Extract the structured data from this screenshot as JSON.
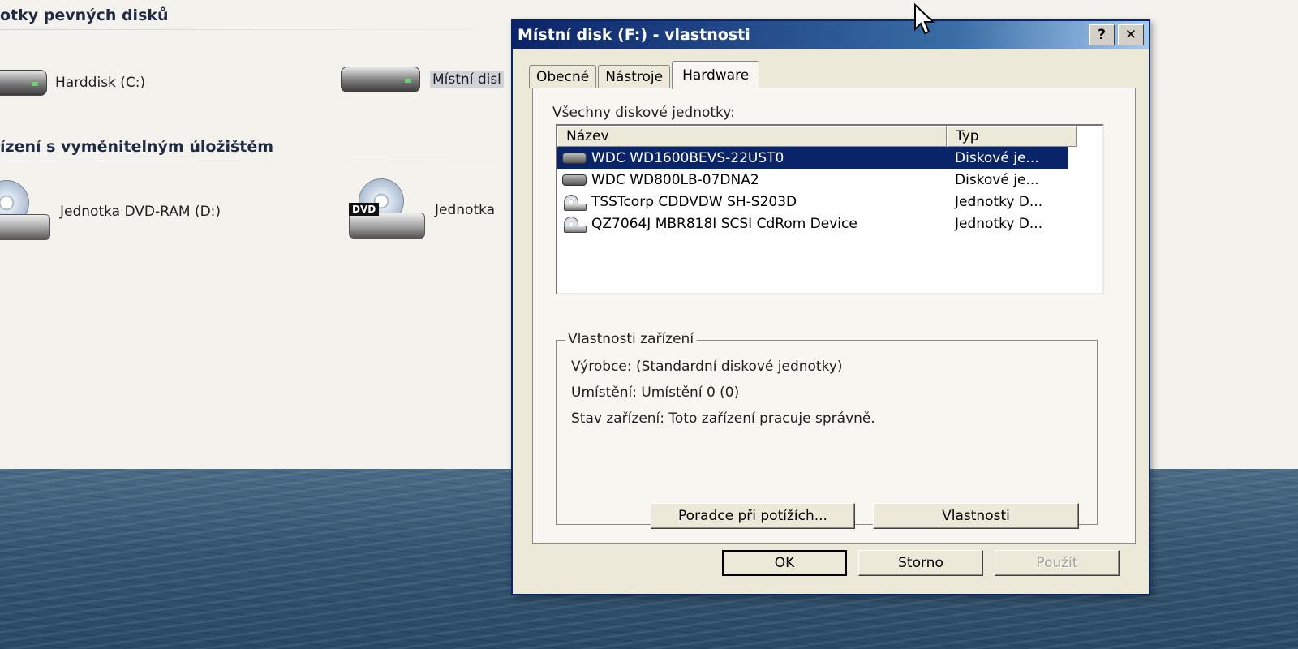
{
  "explorer": {
    "group_fixed": "otky pevných disků",
    "group_removable": "ízení s vyměnitelným úložištěm",
    "items": {
      "hdd_c": "Harddisk (C:)",
      "hdd_f": "Místní disl",
      "dvd_d": "Jednotka DVD-RAM (D:)",
      "dvd_other": "Jednotka",
      "dvd_badge": "DVD"
    }
  },
  "dialog": {
    "title": "Místní disk (F:) - vlastnosti",
    "help_button": "?",
    "close_button": "✕",
    "tabs": [
      "Obecné",
      "Nástroje",
      "Hardware"
    ],
    "active_tab": "Hardware",
    "list_caption": "Všechny diskové jednotky:",
    "columns": {
      "name": "Název",
      "type": "Typ"
    },
    "devices": [
      {
        "name": "WDC WD1600BEVS-22UST0",
        "type": "Diskové je...",
        "icon": "hdd-icon"
      },
      {
        "name": "WDC WD800LB-07DNA2",
        "type": "Diskové je...",
        "icon": "hdd-icon"
      },
      {
        "name": "TSSTcorp CDDVDW SH-S203D",
        "type": "Jednotky D...",
        "icon": "cd-drive-icon"
      },
      {
        "name": "QZ7064J MBR818I SCSI CdRom Device",
        "type": "Jednotky D...",
        "icon": "cd-drive-icon"
      }
    ],
    "selected_index": 0,
    "properties": {
      "legend": "Vlastnosti zařízení",
      "manufacturer": "Výrobce: (Standardní diskové jednotky)",
      "location": "Umístění: Umístění 0 (0)",
      "status": "Stav zařízení: Toto zařízení pracuje správně."
    },
    "buttons": {
      "troubleshoot": "Poradce při potížích...",
      "properties": "Vlastnosti",
      "ok": "OK",
      "cancel": "Storno",
      "apply": "Použít"
    }
  },
  "colors": {
    "titlebar": "#0a246a",
    "selection": "#0a246a",
    "dialog_bg": "#ece9d8"
  }
}
